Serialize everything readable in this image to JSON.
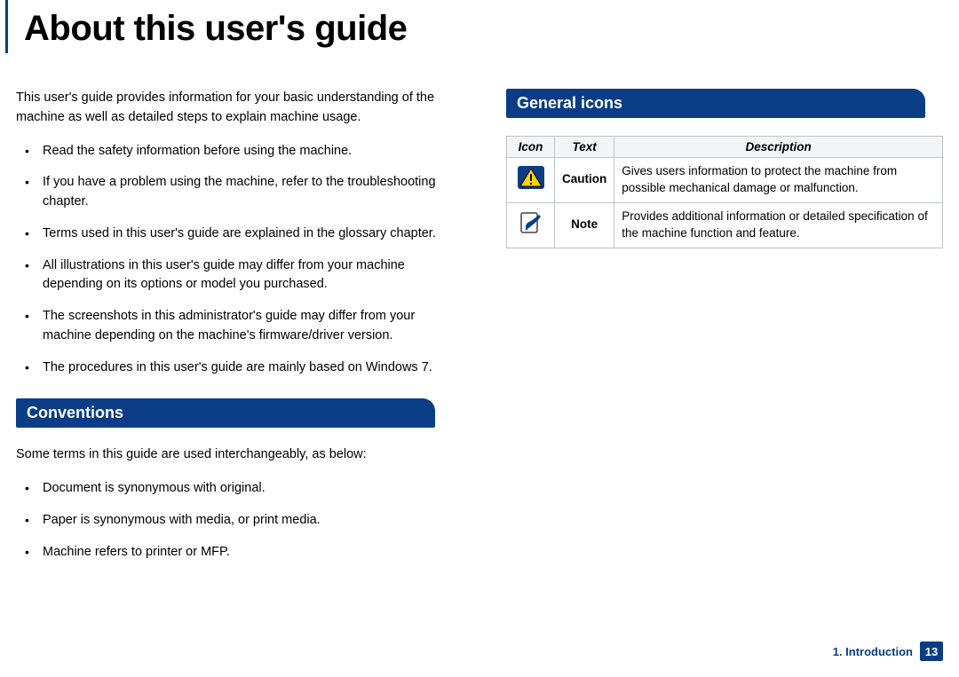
{
  "title": "About this user's guide",
  "intro": "This user's guide provides information for your basic understanding of the machine as well as detailed steps to explain machine usage.",
  "bullets_main": [
    "Read the safety information before using the machine.",
    "If you have a problem using the machine, refer to the troubleshooting chapter.",
    "Terms used in this user's guide are explained in the glossary chapter.",
    "All illustrations in this user's guide may differ from your machine depending on its options or model you purchased.",
    "The screenshots in this administrator's guide may differ from your machine depending on the machine's firmware/driver version.",
    "The procedures in this user's guide are mainly based on Windows 7."
  ],
  "section_conventions": {
    "heading": "Conventions",
    "intro": "Some terms in this guide are used interchangeably, as below:",
    "bullets": [
      "Document is synonymous with original.",
      "Paper is synonymous with media, or print media.",
      "Machine refers to printer or MFP."
    ]
  },
  "section_icons": {
    "heading": "General icons",
    "headers": {
      "icon": "Icon",
      "text": "Text",
      "desc": "Description"
    },
    "rows": [
      {
        "label": "Caution",
        "desc": "Gives users information to protect the machine from possible mechanical damage or malfunction."
      },
      {
        "label": "Note",
        "desc": "Provides additional information or detailed specification of the machine function and feature."
      }
    ]
  },
  "footer": {
    "chapter": "1.  Introduction",
    "page": "13"
  }
}
